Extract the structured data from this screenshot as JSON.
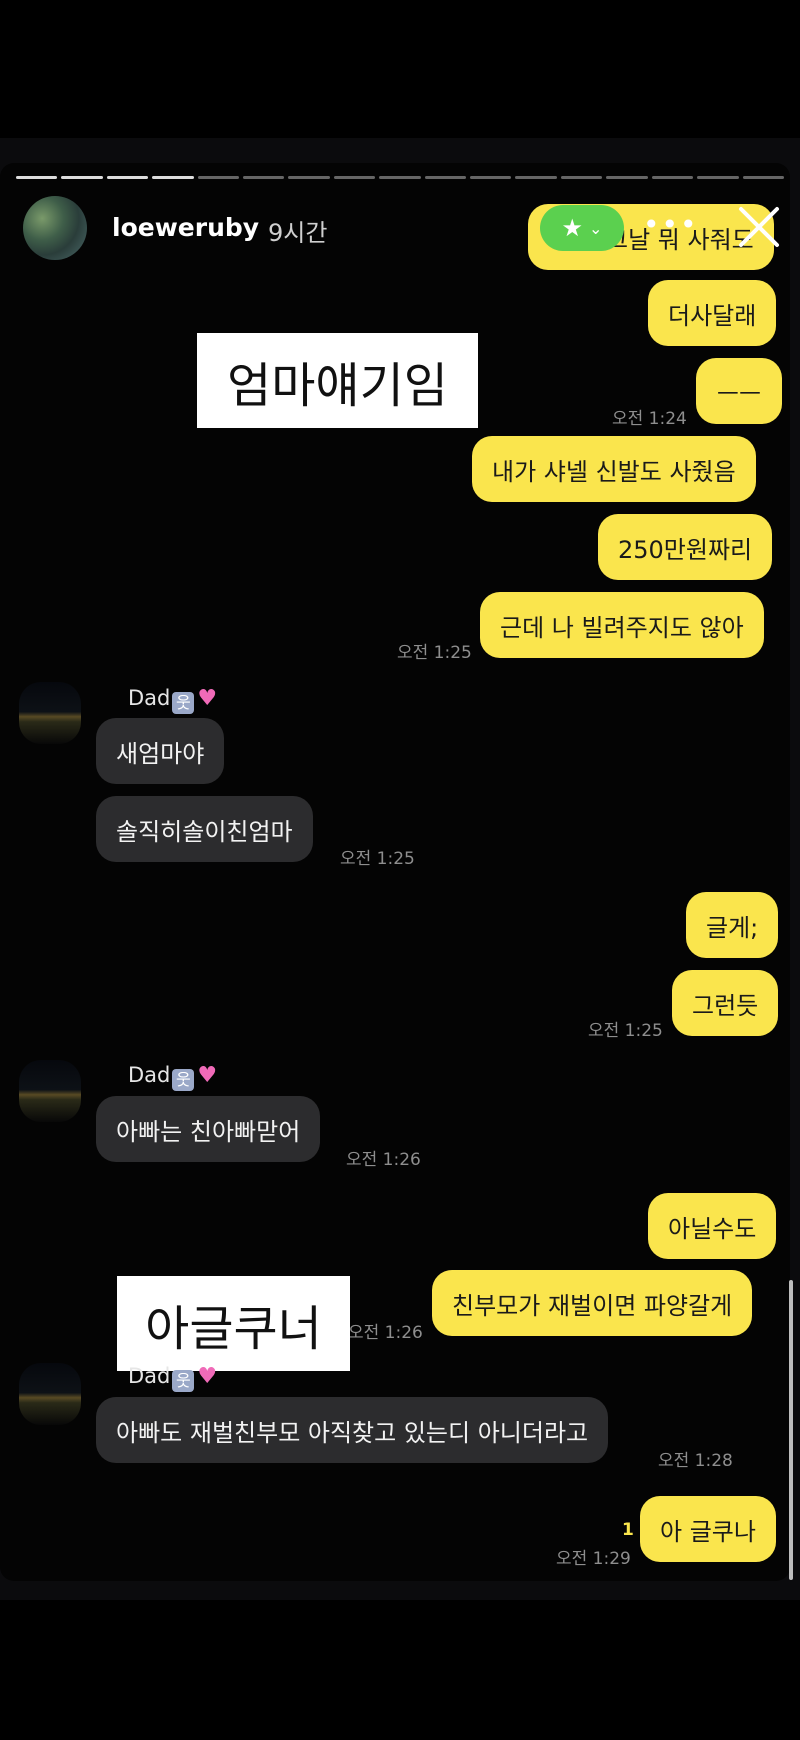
{
  "story": {
    "username": "loeweruby",
    "time_ago": "9시간",
    "dots": "•••",
    "progress_segments": 17,
    "progress_done": 4
  },
  "overlay_labels": {
    "top": "엄마얘기임",
    "bottom": "아글쿠너"
  },
  "colors": {
    "outgoing_bubble": "#fae54d",
    "incoming_bubble": "#2c2c2e",
    "star_pill": "#5bd04f"
  },
  "chat": {
    "out1": {
      "text": "그날 뭐 사줘도",
      "time": ""
    },
    "out2": {
      "text": "더사달래"
    },
    "out3": {
      "text": "ㅡㅡ",
      "time": "오전 1:24"
    },
    "out4": {
      "text": "내가 샤넬 신발도 사줬음"
    },
    "out5": {
      "text": "250만원짜리"
    },
    "out6": {
      "text": "근데 나 빌려주지도 않아",
      "time": "오전 1:25"
    },
    "in_group1": {
      "sender": "Dad",
      "messages": [
        "새엄마야",
        "솔직히솔이친엄마"
      ],
      "time": "오전 1:25"
    },
    "out7": {
      "text": "글게;"
    },
    "out8": {
      "text": "그런듯",
      "time": "오전 1:25"
    },
    "in_group2": {
      "sender": "Dad",
      "messages": [
        "아빠는 친아빠맏어"
      ],
      "time": "오전 1:26"
    },
    "out9": {
      "text": "아닐수도"
    },
    "out10": {
      "text": "친부모가 재벌이면 파양갈게",
      "time": "오전 1:26"
    },
    "in_group3": {
      "sender": "Dad",
      "messages": [
        "아빠도 재벌친부모 아직찾고 있는디 아니더라고"
      ],
      "time": "오전 1:28"
    },
    "out11": {
      "text": "아 글쿠나",
      "time": "오전 1:29",
      "unread": "1"
    }
  }
}
